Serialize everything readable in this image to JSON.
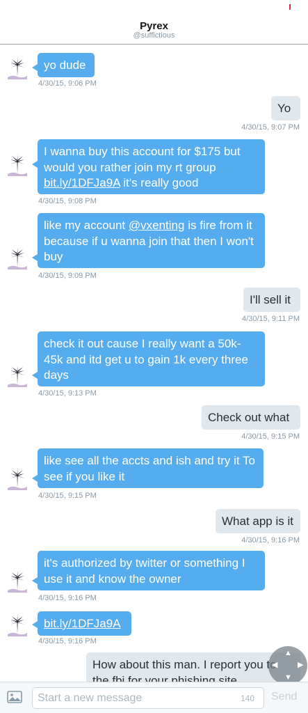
{
  "header": {
    "title": "Pyrex",
    "handle": "@suffictious"
  },
  "messages": [
    {
      "dir": "in",
      "segments": [
        {
          "text": "yo dude"
        }
      ],
      "time": "4/30/15, 9:06 PM"
    },
    {
      "dir": "out",
      "segments": [
        {
          "text": "Yo"
        }
      ],
      "time": "4/30/15, 9:07 PM"
    },
    {
      "dir": "in",
      "segments": [
        {
          "text": "I wanna buy this account for $175 but would you rather join my rt group "
        },
        {
          "text": "bit.ly/1DFJa9A",
          "link": true
        },
        {
          "text": " it's really good"
        }
      ],
      "time": "4/30/15, 9:08 PM"
    },
    {
      "dir": "in",
      "segments": [
        {
          "text": "like my account "
        },
        {
          "text": "@vxenting",
          "link": true
        },
        {
          "text": " is fire from it because if u wanna join that then I won't buy"
        }
      ],
      "time": "4/30/15, 9:09 PM"
    },
    {
      "dir": "out",
      "segments": [
        {
          "text": "I'll sell it"
        }
      ],
      "time": "4/30/15, 9:11 PM"
    },
    {
      "dir": "in",
      "segments": [
        {
          "text": "check it out cause I really want a 50k-45k and itd get u to gain 1k every three days"
        }
      ],
      "time": "4/30/15, 9:13 PM"
    },
    {
      "dir": "out",
      "segments": [
        {
          "text": "Check out what"
        }
      ],
      "time": "4/30/15, 9:15 PM"
    },
    {
      "dir": "in",
      "segments": [
        {
          "text": "like see all the accts and ish and try it To see if you like it"
        }
      ],
      "time": "4/30/15, 9:15 PM"
    },
    {
      "dir": "out",
      "segments": [
        {
          "text": "What app is it"
        }
      ],
      "time": "4/30/15, 9:16 PM"
    },
    {
      "dir": "in",
      "segments": [
        {
          "text": "it's authorized by twitter or something I use it and know the owner"
        }
      ],
      "time": "4/30/15, 9:16 PM"
    },
    {
      "dir": "in",
      "segments": [
        {
          "text": "bit.ly/1DFJa9A",
          "link": true
        }
      ],
      "time": "4/30/15, 9:16 PM"
    },
    {
      "dir": "out",
      "segments": [
        {
          "text": "How about this man. I report you to the fbi for your phishing site"
        }
      ],
      "time": ""
    }
  ],
  "composer": {
    "placeholder": "Start a new message",
    "char_count": "140",
    "send_label": "Send"
  },
  "icons": {
    "avatar": "palm-tree-avatar-icon",
    "attach": "image-attach-icon",
    "scroll": "scroll-control-icon"
  },
  "colors": {
    "incoming_bubble": "#55acee",
    "outgoing_bubble": "#e1e8ed",
    "timestamp": "#8899a6"
  }
}
